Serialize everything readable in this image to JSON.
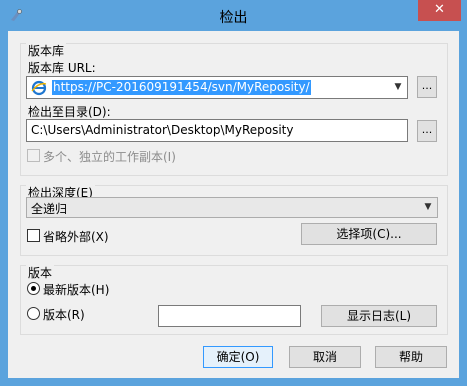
{
  "window": {
    "title": "检出",
    "close_label": "✕"
  },
  "repo_group": {
    "title": "版本库",
    "url_label": "版本库 URL:",
    "url_value": "https://PC-201609191454/svn/MyReposity/",
    "browse_label": "...",
    "checkout_dir_label": "检出至目录(D):",
    "checkout_dir_value": "C:\\Users\\Administrator\\Desktop\\MyReposity",
    "browse2_label": "...",
    "independent_wc_label": "多个、独立的工作副本(I)"
  },
  "depth_group": {
    "title": "检出深度(E)",
    "depth_value": "全递归",
    "omit_externals_label": "省略外部(X)",
    "choose_items_label": "选择项(C)..."
  },
  "revision_group": {
    "title": "版本",
    "head_label": "最新版本(H)",
    "revision_label": "版本(R)",
    "revision_value": "",
    "show_log_label": "显示日志(L)"
  },
  "footer": {
    "ok_label": "确定(O)",
    "cancel_label": "取消",
    "help_label": "帮助"
  }
}
